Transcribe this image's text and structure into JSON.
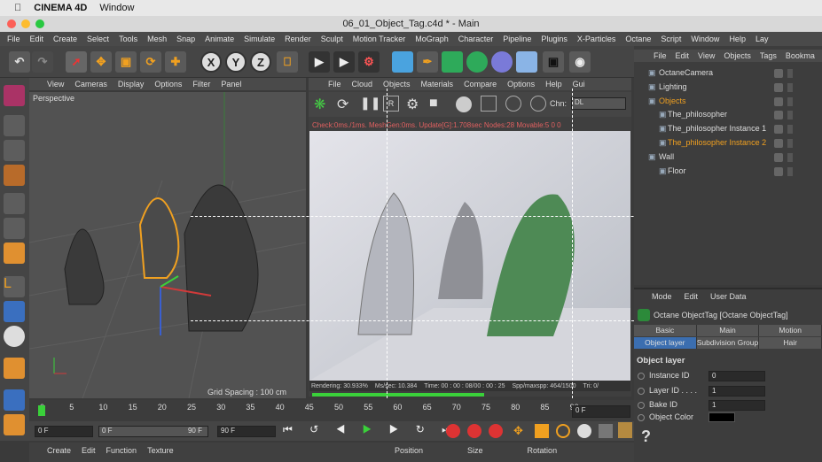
{
  "mac_menu": {
    "app": "CINEMA 4D",
    "window": "Window"
  },
  "window_title": "06_01_Object_Tag.c4d * - Main",
  "main_menu": [
    "File",
    "Edit",
    "Create",
    "Select",
    "Tools",
    "Mesh",
    "Snap",
    "Animate",
    "Simulate",
    "Render",
    "Sculpt",
    "Motion Tracker",
    "MoGraph",
    "Character",
    "Pipeline",
    "Plugins",
    "X-Particles",
    "Octane",
    "Script",
    "Window",
    "Help",
    "Lay"
  ],
  "toolbar_axes": [
    "X",
    "Y",
    "Z"
  ],
  "viewport": {
    "menu": [
      "View",
      "Cameras",
      "Display",
      "Options",
      "Filter",
      "Panel"
    ],
    "label": "Perspective",
    "grid_spacing": "Grid Spacing : 100 cm"
  },
  "live_viewer": {
    "menu": [
      "File",
      "Cloud",
      "Objects",
      "Materials",
      "Compare",
      "Options",
      "Help",
      "Gui"
    ],
    "channel_label": "Chn:",
    "channel_value": "DL",
    "status_line": "Check:0ms./1ms. MeshGen:0ms. Update[G]:1.708sec Nodes:28 Movable:5  0 0",
    "render_stats": [
      "Rendering: 30.933%",
      "Ms/sec: 10.384",
      "Time: 00 : 00 : 08/00 : 00 : 25",
      "Spp/maxspp: 464/1500",
      "Tri: 0/"
    ]
  },
  "timeline": {
    "ticks": [
      "0",
      "5",
      "10",
      "15",
      "20",
      "25",
      "30",
      "35",
      "40",
      "45",
      "50",
      "55",
      "60",
      "65",
      "70",
      "75",
      "80",
      "85",
      "90"
    ],
    "frame_display": "0 F",
    "start_field": "0 F",
    "range_start": "0 F",
    "range_end": "90 F",
    "end_field": "90 F"
  },
  "bottom_bar": {
    "left_menu": [
      "Create",
      "Edit",
      "Function",
      "Texture"
    ],
    "coord_headers": [
      "Position",
      "Size",
      "Rotation"
    ]
  },
  "object_manager": {
    "menu": [
      "File",
      "Edit",
      "View",
      "Objects",
      "Tags",
      "Bookma"
    ],
    "objects": [
      {
        "name": "OctaneCamera",
        "indent": 0,
        "color": "#dddddd"
      },
      {
        "name": "Lighting",
        "indent": 0,
        "color": "#dddddd"
      },
      {
        "name": "Objects",
        "indent": 0,
        "color": "#f0a020"
      },
      {
        "name": "The_philosopher",
        "indent": 1,
        "color": "#dddddd"
      },
      {
        "name": "The_philosopher Instance 1",
        "indent": 1,
        "color": "#dddddd"
      },
      {
        "name": "The_philosopher Instance 2",
        "indent": 1,
        "color": "#f0a020"
      },
      {
        "name": "Wall",
        "indent": 0,
        "color": "#dddddd"
      },
      {
        "name": "Floor",
        "indent": 1,
        "color": "#dddddd"
      }
    ]
  },
  "attributes": {
    "menu": [
      "Mode",
      "Edit",
      "User Data"
    ],
    "title": "Octane ObjectTag [Octane ObjectTag]",
    "tabs_row1": [
      "Basic",
      "Main",
      "Motion"
    ],
    "tabs_row2": [
      "Object layer",
      "Subdivision Group",
      "Hair"
    ],
    "section": "Object layer",
    "fields": [
      {
        "label": "Instance ID",
        "value": "0"
      },
      {
        "label": "Layer ID . . . .",
        "value": "1"
      },
      {
        "label": "Bake ID",
        "value": "1"
      }
    ],
    "color_label": "Object Color",
    "help": "?"
  }
}
